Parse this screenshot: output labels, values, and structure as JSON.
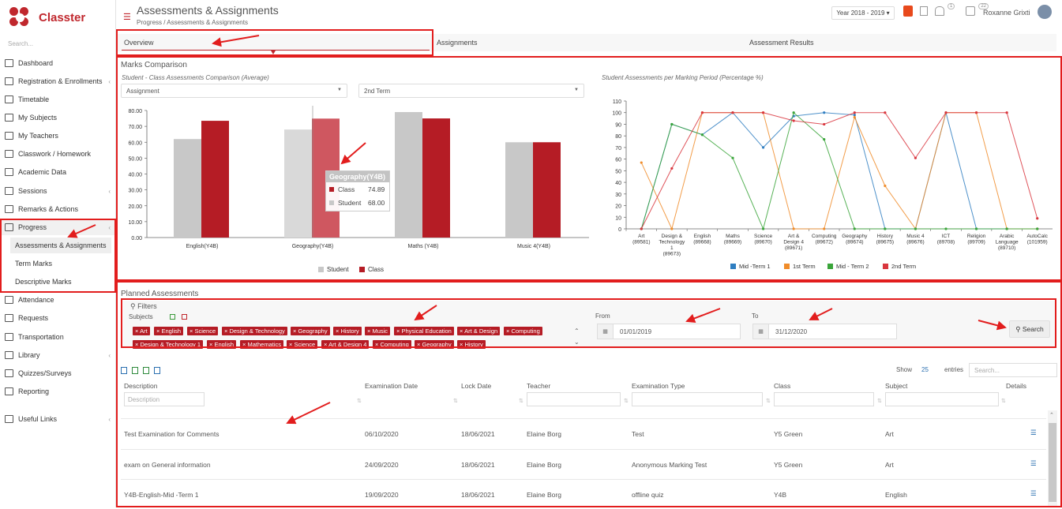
{
  "app": {
    "name": "Classter"
  },
  "sidebar": {
    "search_placeholder": "Search...",
    "items": [
      {
        "label": "Dashboard",
        "icon": "laptop-icon"
      },
      {
        "label": "Registration & Enrollments",
        "icon": "register-icon"
      },
      {
        "label": "Timetable",
        "icon": "calendar-icon"
      },
      {
        "label": "My Subjects",
        "icon": "book-icon"
      },
      {
        "label": "My Teachers",
        "icon": "teachers-icon"
      },
      {
        "label": "Classwork / Homework",
        "icon": "homework-icon"
      },
      {
        "label": "Academic Data",
        "icon": "academic-icon"
      },
      {
        "label": "Sessions",
        "icon": "sessions-icon"
      },
      {
        "label": "Remarks & Actions",
        "icon": "remarks-icon"
      },
      {
        "label": "Progress",
        "icon": "graduation-cap-icon"
      },
      {
        "label": "Attendance",
        "icon": "attendance-icon"
      },
      {
        "label": "Requests",
        "icon": "requests-icon"
      },
      {
        "label": "Transportation",
        "icon": "bus-icon"
      },
      {
        "label": "Library",
        "icon": "library-icon"
      },
      {
        "label": "Quizzes/Surveys",
        "icon": "quiz-icon"
      },
      {
        "label": "Reporting",
        "icon": "reporting-icon"
      },
      {
        "label": "Useful Links",
        "icon": "link-icon"
      }
    ],
    "progress_sub": [
      "Assessments & Assignments",
      "Term Marks",
      "Descriptive Marks"
    ]
  },
  "header": {
    "title": "Assessments & Assignments",
    "breadcrumb": "Progress  /  Assessments & Assignments",
    "year": "Year 2018 - 2019",
    "notif_count": "1",
    "msg_count": "22",
    "user": "Roxanne Grixti"
  },
  "tabs": [
    "Overview",
    "Assignments",
    "Assessment Results"
  ],
  "marks": {
    "section_title": "Marks Comparison",
    "left_subtitle": "Student - Class Assessments Comparison (Average)",
    "right_subtitle": "Student Assessments per Marking Period (Percentage %)",
    "select_type": "Assignment",
    "select_term": "2nd Term",
    "tooltip": {
      "title": "Geography(Y4B)",
      "class_label": "Class",
      "class_value": "74.89",
      "student_label": "Student",
      "student_value": "68.00"
    }
  },
  "chart_data": [
    {
      "type": "bar",
      "title": "Student - Class Assessments Comparison (Average)",
      "categories": [
        "English(Y4B)",
        "Geography(Y4B)",
        "Maths (Y4B)",
        "Music 4(Y4B)"
      ],
      "series": [
        {
          "name": "Student",
          "values": [
            62,
            68,
            79,
            60
          ]
        },
        {
          "name": "Class",
          "values": [
            73.5,
            74.89,
            75,
            60
          ]
        }
      ],
      "ylim": [
        0,
        80
      ],
      "yticks": [
        "0.00",
        "10.00",
        "20.00",
        "30.00",
        "40.00",
        "50.00",
        "60.00",
        "70.00",
        "80.00"
      ],
      "legend": "bottom",
      "colors": {
        "Student": "#c8c8c8",
        "Class": "#b51c25"
      }
    },
    {
      "type": "line",
      "title": "Student Assessments per Marking Period (Percentage %)",
      "categories": [
        "Art (89581)",
        "Design & Technology 1 (89673)",
        "English (89668)",
        "Maths (89669)",
        "Science (89670)",
        "Art & Design 4 (89671)",
        "Computing (89672)",
        "Geography (89674)",
        "History (89675)",
        "Music 4 (89676)",
        "ICT (89708)",
        "Religion (89709)",
        "Arabic Language (89710)",
        "AutoCalc (101959)"
      ],
      "ylim": [
        0,
        110
      ],
      "yticks": [
        0,
        10,
        20,
        30,
        40,
        50,
        60,
        70,
        80,
        90,
        100,
        110
      ],
      "series": [
        {
          "name": "Mid -Term 1",
          "color": "#2f7ec1",
          "values": [
            0,
            90,
            81,
            100,
            70,
            97,
            100,
            98,
            0,
            0,
            100,
            0,
            0,
            0
          ]
        },
        {
          "name": "1st Term",
          "color": "#f08c2a",
          "values": [
            57,
            0,
            100,
            100,
            100,
            0,
            0,
            96,
            37,
            0,
            100,
            100,
            0,
            0
          ]
        },
        {
          "name": "Mid - Term 2",
          "color": "#3aa53a",
          "values": [
            0,
            90,
            81,
            61,
            0,
            100,
            77,
            0,
            0,
            0,
            0,
            0,
            0,
            0
          ]
        },
        {
          "name": "2nd Term",
          "color": "#d9363e",
          "values": [
            0,
            52,
            100,
            100,
            100,
            93,
            90,
            100,
            100,
            61,
            100,
            100,
            100,
            9
          ]
        }
      ],
      "legend": "bottom"
    }
  ],
  "planned": {
    "section_title": "Planned Assessments",
    "filters_label": "Filters",
    "subjects_label": "Subjects",
    "chips_row1": [
      "Art",
      "English",
      "Science",
      "Design & Technology",
      "Geography",
      "History",
      "Music",
      "Physical Education",
      "Art & Design",
      "Computing"
    ],
    "chips_row2": [
      "Design & Technology 1",
      "English",
      "Mathematics",
      "Science",
      "Art & Design 4",
      "Computing",
      "Geography",
      "History"
    ],
    "from_label": "From",
    "from_value": "01/01/2019",
    "to_label": "To",
    "to_value": "31/12/2020",
    "search_button": "Search",
    "show_label": "Show",
    "show_value": "25",
    "entries_label": "entries",
    "search_placeholder": "Search...",
    "columns": [
      "Description",
      "Examination Date",
      "Lock Date",
      "Teacher",
      "Examination Type",
      "Class",
      "Subject",
      "Details"
    ],
    "description_placeholder": "Description",
    "rows": [
      [
        "Test Examination for Comments",
        "06/10/2020",
        "18/06/2021",
        "Elaine Borg",
        "Test",
        "Y5 Green",
        "Art"
      ],
      [
        "exam on General information",
        "24/09/2020",
        "18/06/2021",
        "Elaine Borg",
        "Anonymous Marking Test",
        "Y5 Green",
        "Art"
      ],
      [
        "Y4B-English-Mid -Term 1",
        "19/09/2020",
        "18/06/2021",
        "Elaine Borg",
        "offline quiz",
        "Y4B",
        "English"
      ]
    ]
  }
}
